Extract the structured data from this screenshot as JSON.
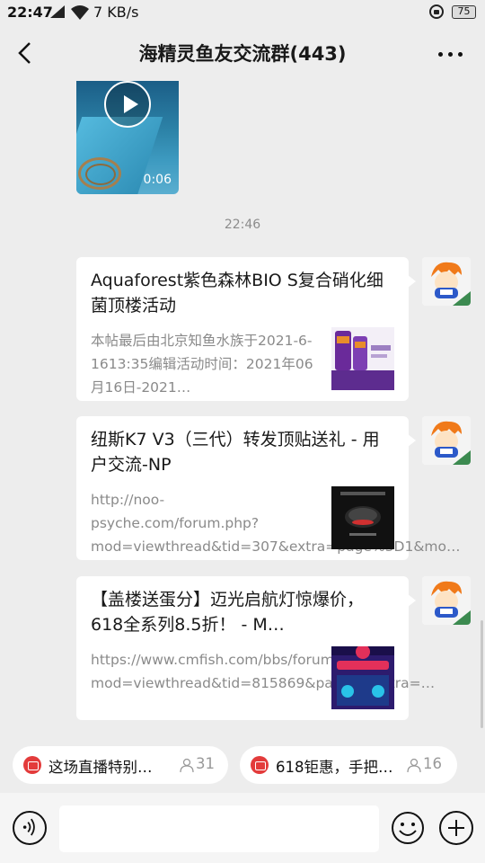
{
  "status_bar": {
    "time": "22:47",
    "speed": "7 KB/s",
    "battery": "75"
  },
  "header": {
    "title": "海精灵鱼友交流群(443)"
  },
  "video": {
    "duration": "0:06"
  },
  "timestamp": "22:46",
  "messages": [
    {
      "title": "Aquaforest紫色森林BIO S复合硝化细菌顶楼活动",
      "desc": "本帖最后由北京知鱼水族于2021-6-1613:35编辑活动时间：2021年06月16日-2021…"
    },
    {
      "title": "纽斯K7 V3（三代）转发顶贴送礼 - 用户交流-NP",
      "desc": "http://noo-psyche.com/forum.php?mod=viewthread&tid=307&extra=page%3D1&mo…"
    },
    {
      "title": "【盖楼送蛋分】迈光启航灯惊爆价，618全系列8.5折！ - M…",
      "desc": "https://www.cmfish.com/bbs/forum.php?mod=viewthread&tid=815869&page=&extra=…"
    }
  ],
  "live_pills": [
    {
      "text": "这场直播特别…",
      "count": "31"
    },
    {
      "text": "618钜惠，手把…",
      "count": "16"
    }
  ],
  "icons": {
    "back": "chevron-left-icon",
    "more": "more-dots-icon",
    "voice": "voice-icon",
    "emoji": "emoji-icon",
    "plus": "plus-icon"
  }
}
